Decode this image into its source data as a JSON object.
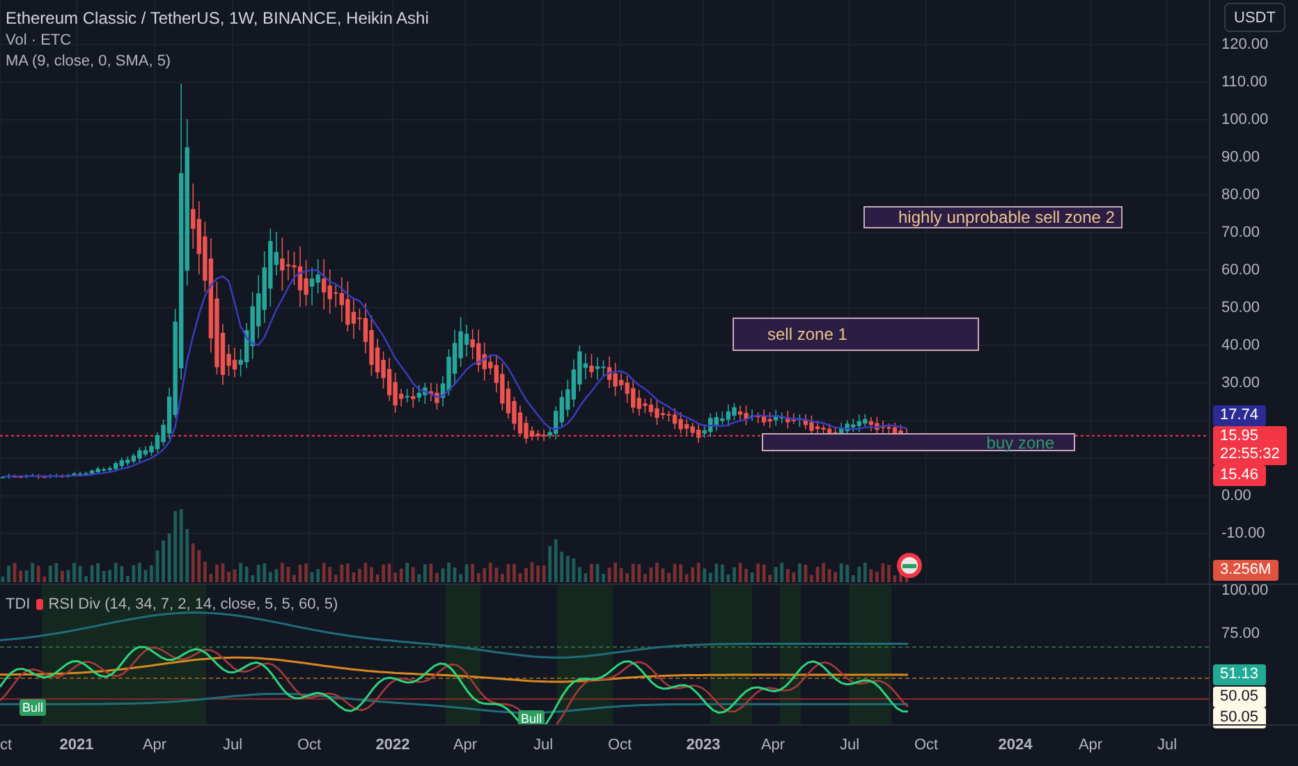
{
  "legend": {
    "title": "Ethereum Classic / TetherUS, 1W, BINANCE, Heikin Ashi",
    "lines": [
      "Vol · ETC",
      "MA (9, close, 0, SMA, 5)"
    ]
  },
  "currency_button": "USDT",
  "price_axis": [
    "120.00",
    "110.00",
    "100.00",
    "90.00",
    "80.00",
    "70.00",
    "60.00",
    "50.00",
    "40.00",
    "30.00",
    "0.00",
    "-10.00"
  ],
  "price_badges": [
    {
      "lines": [
        "17.74"
      ],
      "color": "#2a2c93"
    },
    {
      "lines": [
        "15.95",
        "22:55:32"
      ],
      "color": "#f23645"
    },
    {
      "lines": [
        "15.46"
      ],
      "color": "#f23645"
    },
    {
      "lines": [
        "3.256M"
      ],
      "color": "#e0533f"
    }
  ],
  "zones": [
    {
      "label": "highly unprobable sell zone 2",
      "kind": "sell"
    },
    {
      "label": "sell zone 1",
      "kind": "sell"
    },
    {
      "label": "buy zone",
      "kind": "buy"
    }
  ],
  "indicator": {
    "name": "TDI",
    "title": "RSI Div (14, 34, 7, 2, 14, close, 5, 5, 60, 5)",
    "axis": [
      "100.00",
      "75.00"
    ],
    "badges": [
      {
        "text": "51.13",
        "color": "#22ab94"
      },
      {
        "text": "50.05",
        "color": "#fff8e6"
      },
      {
        "text": "50.05",
        "color": "#fff8e6"
      }
    ],
    "signals": [
      "Bull",
      "Bull"
    ]
  },
  "time_axis": [
    {
      "label": "ct",
      "kind": "month"
    },
    {
      "label": "2021",
      "kind": "year"
    },
    {
      "label": "Apr",
      "kind": "month"
    },
    {
      "label": "Jul",
      "kind": "month"
    },
    {
      "label": "Oct",
      "kind": "month"
    },
    {
      "label": "2022",
      "kind": "year"
    },
    {
      "label": "Apr",
      "kind": "month"
    },
    {
      "label": "Jul",
      "kind": "month"
    },
    {
      "label": "Oct",
      "kind": "month"
    },
    {
      "label": "2023",
      "kind": "year"
    },
    {
      "label": "Apr",
      "kind": "month"
    },
    {
      "label": "Jul",
      "kind": "month"
    },
    {
      "label": "Oct",
      "kind": "month"
    },
    {
      "label": "2024",
      "kind": "year"
    },
    {
      "label": "Apr",
      "kind": "month"
    },
    {
      "label": "Jul",
      "kind": "month"
    }
  ]
}
